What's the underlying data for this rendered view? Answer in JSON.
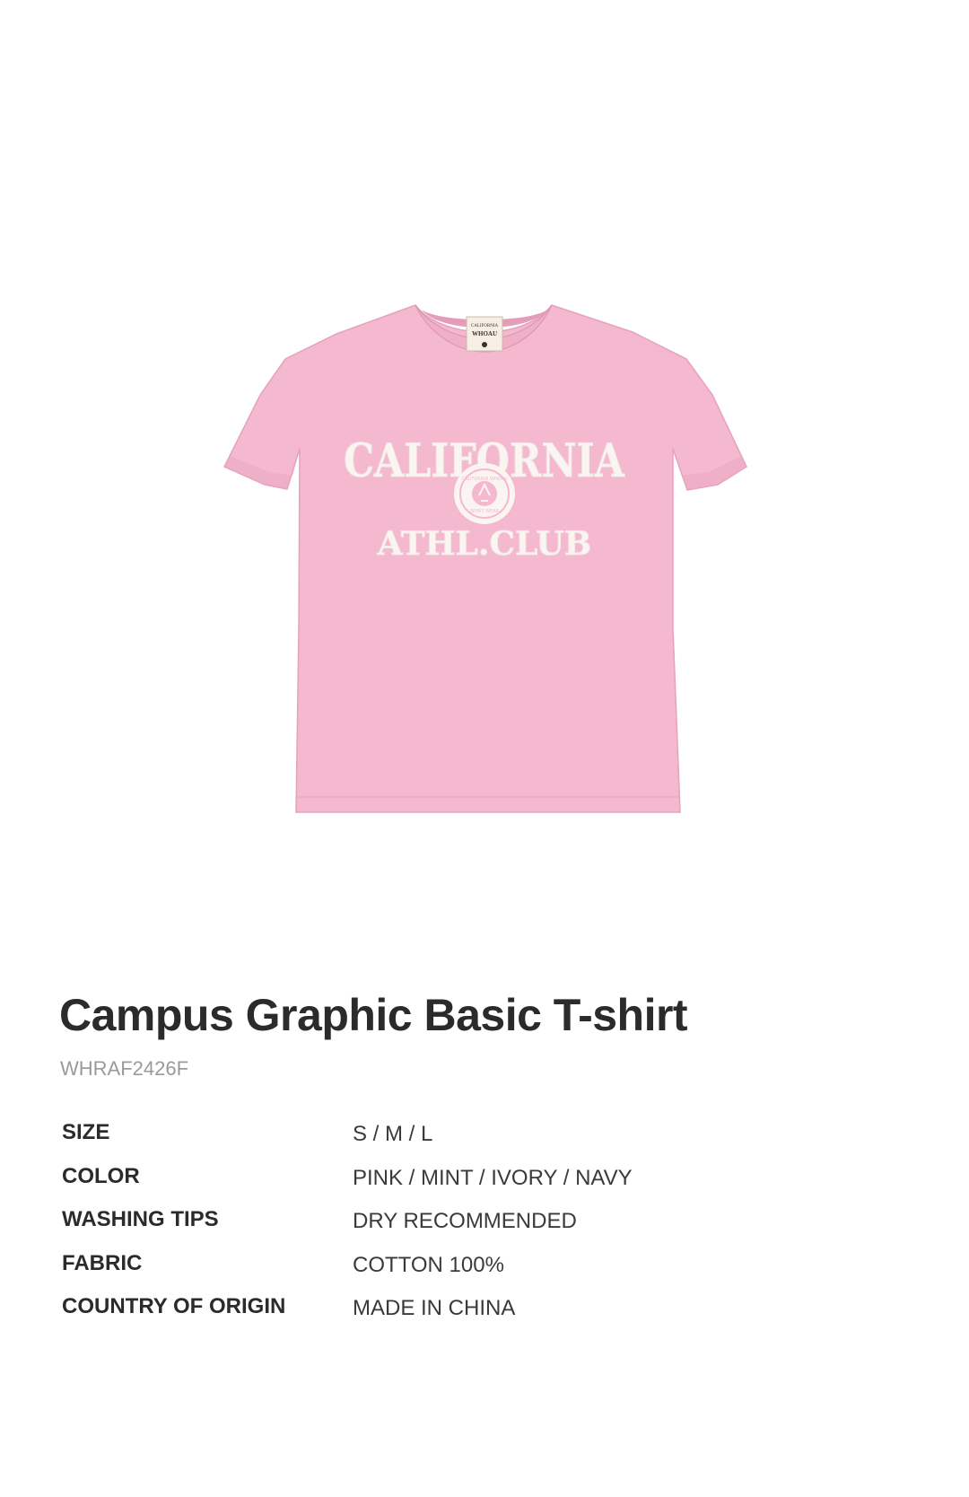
{
  "product": {
    "image": {
      "garment_color": "#f4b8cf",
      "print_color": "#fbf5f2",
      "print_line_1": "CALIFORNIA",
      "print_line_2": "ATHL.CLUB",
      "seal_top_text": "CALIFORNIA WHOAU",
      "seal_bottom_text": "SPIRIT WEAR",
      "neck_label_line_1": "CALIFORNIA",
      "neck_label_line_2": "WHOAU"
    },
    "title": "Campus Graphic Basic T-shirt",
    "code": "WHRAF2426F"
  },
  "specs": [
    {
      "label": "SIZE",
      "value": "S / M / L"
    },
    {
      "label": "COLOR",
      "value": "PINK / MINT / IVORY / NAVY"
    },
    {
      "label": "WASHING TIPS",
      "value": "DRY RECOMMENDED"
    },
    {
      "label": "FABRIC",
      "value": "COTTON 100%"
    },
    {
      "label": "COUNTRY OF ORIGIN",
      "value": "MADE IN CHINA"
    }
  ]
}
